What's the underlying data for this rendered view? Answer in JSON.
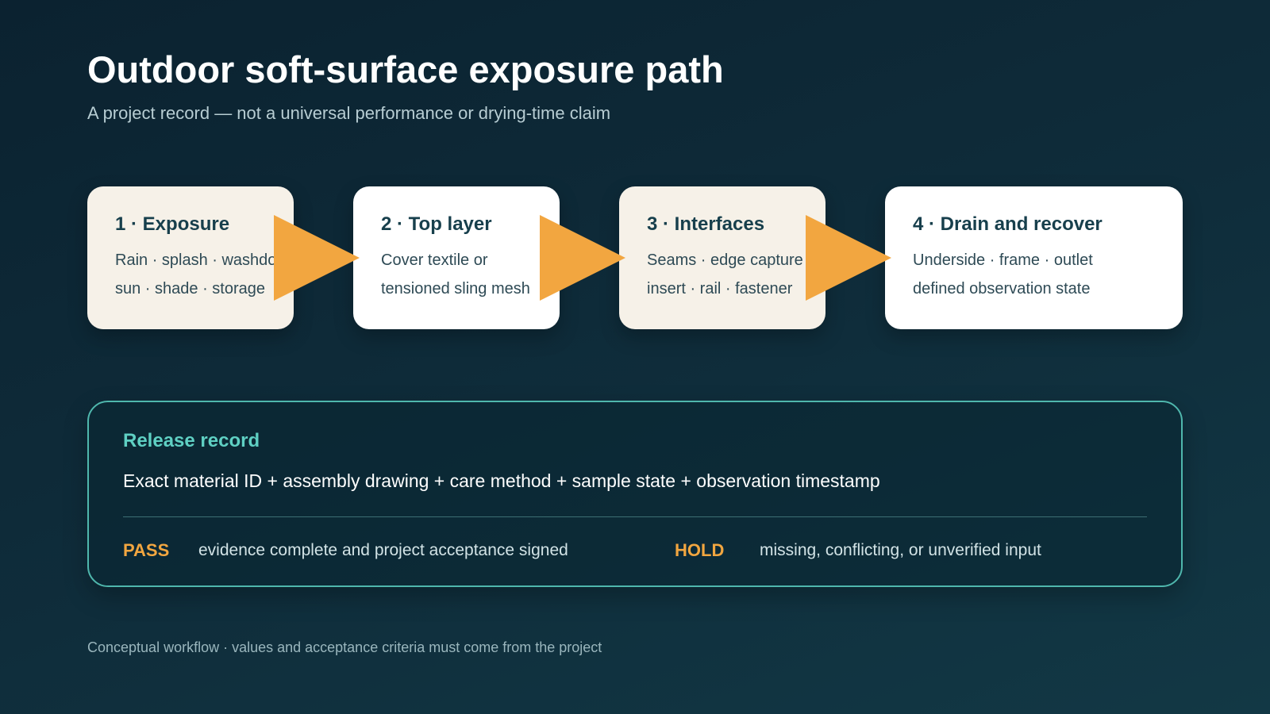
{
  "title": "Outdoor soft-surface exposure path",
  "subtitle": "A project record — not a universal performance or drying-time claim",
  "steps": [
    {
      "title": "1 · Exposure",
      "lines": [
        "Rain · splash · washdown",
        "sun · shade · storage"
      ]
    },
    {
      "title": "2 · Top layer",
      "lines": [
        "Cover textile or",
        "tensioned sling mesh"
      ]
    },
    {
      "title": "3 · Interfaces",
      "lines": [
        "Seams · edge capture",
        "insert · rail · fastener"
      ]
    },
    {
      "title": "4 · Drain and recover",
      "lines": [
        "Underside · frame · outlet",
        "defined observation state"
      ]
    }
  ],
  "release": {
    "label": "Release record",
    "text": "Exact material ID + assembly drawing + care method + sample state + observation timestamp",
    "pass_label": "PASS",
    "pass_text": "evidence complete and project acceptance signed",
    "hold_label": "HOLD",
    "hold_text": "missing, conflicting, or unverified input"
  },
  "footer": "Conceptual workflow · values and acceptance criteria must come from the project",
  "colors": {
    "arrow": "#f2a640",
    "accent_teal": "#5fd0c3",
    "status": "#f2a640"
  }
}
